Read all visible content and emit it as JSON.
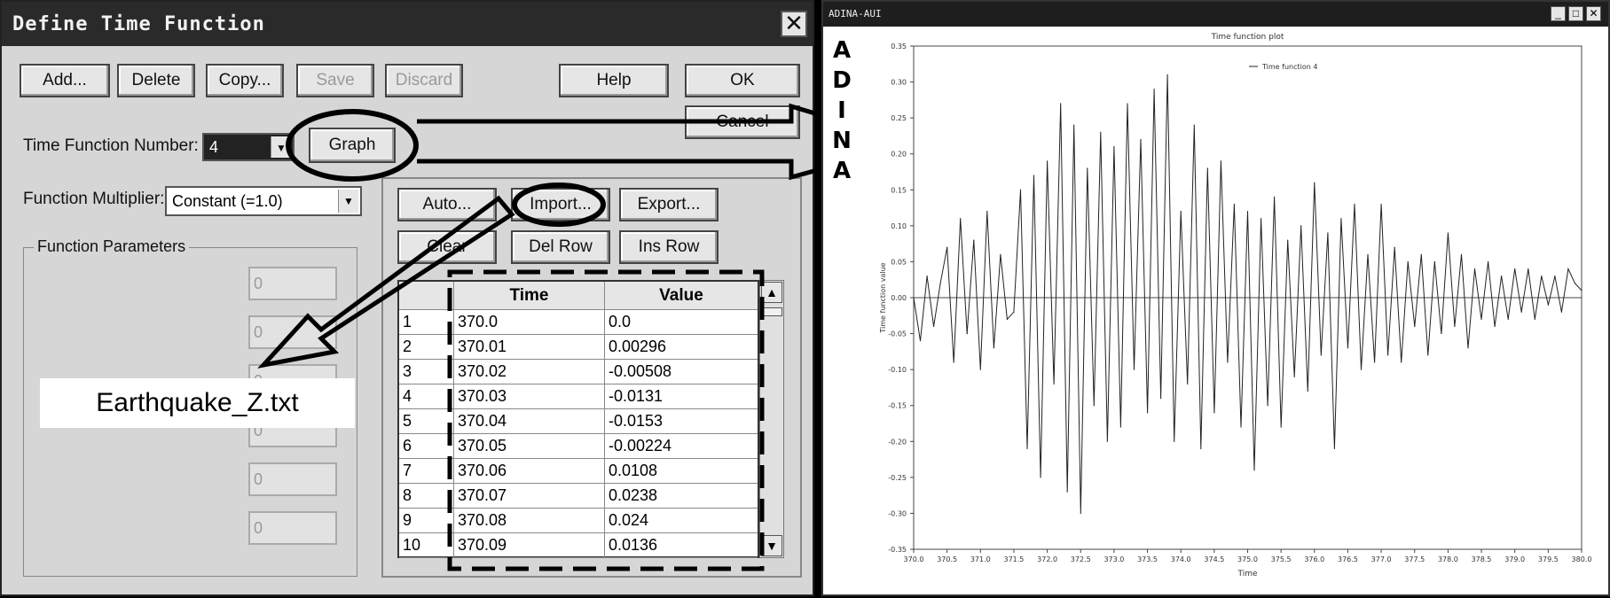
{
  "dialog": {
    "title": "Define Time Function",
    "close_glyph": "✕",
    "buttons": {
      "add": "Add...",
      "delete": "Delete",
      "copy": "Copy...",
      "save": "Save",
      "discard": "Discard",
      "help": "Help",
      "ok": "OK",
      "cancel": "Cancel",
      "graph": "Graph",
      "auto": "Auto...",
      "import": "Import...",
      "export": "Export...",
      "clear": "Clear",
      "del_row": "Del Row",
      "ins_row": "Ins Row"
    },
    "time_function_number_label": "Time Function Number:",
    "time_function_number_value": "4",
    "function_multiplier_label": "Function Multiplier:",
    "function_multiplier_value": "Constant (=1.0)",
    "function_parameters_label": "Function Parameters",
    "parameters": [
      "0",
      "0",
      "0",
      "0",
      "0",
      "0"
    ],
    "table": {
      "columns": [
        "Time",
        "Value"
      ],
      "rows": [
        {
          "n": "1",
          "time": "370.0",
          "value": "0.0"
        },
        {
          "n": "2",
          "time": "370.01",
          "value": "0.00296"
        },
        {
          "n": "3",
          "time": "370.02",
          "value": "-0.00508"
        },
        {
          "n": "4",
          "time": "370.03",
          "value": "-0.0131"
        },
        {
          "n": "5",
          "time": "370.04",
          "value": "-0.0153"
        },
        {
          "n": "6",
          "time": "370.05",
          "value": "-0.00224"
        },
        {
          "n": "7",
          "time": "370.06",
          "value": "0.0108"
        },
        {
          "n": "8",
          "time": "370.07",
          "value": "0.0238"
        },
        {
          "n": "9",
          "time": "370.08",
          "value": "0.024"
        },
        {
          "n": "10",
          "time": "370.09",
          "value": "0.0136"
        }
      ]
    },
    "annotation_filename": "Earthquake_Z.txt"
  },
  "aui_window": {
    "title": "ADINA-AUI",
    "brand_letters": [
      "A",
      "D",
      "I",
      "N",
      "A"
    ]
  },
  "chart_data": {
    "type": "line",
    "title": "Time function plot",
    "xlabel": "Time",
    "ylabel": "Time function value",
    "legend": [
      "Time function 4"
    ],
    "legend_position": "top-center",
    "xlim": [
      370.0,
      380.0
    ],
    "ylim": [
      -0.35,
      0.35
    ],
    "xticks": [
      "370.0",
      "370.5",
      "371.0",
      "371.5",
      "372.0",
      "372.5",
      "373.0",
      "373.5",
      "374.0",
      "374.5",
      "375.0",
      "375.5",
      "376.0",
      "376.5",
      "377.0",
      "377.5",
      "378.0",
      "378.5",
      "379.0",
      "379.5",
      "380.0"
    ],
    "yticks": [
      "0.35",
      "0.30",
      "0.25",
      "0.20",
      "0.15",
      "0.10",
      "0.05",
      "0.00",
      "-0.05",
      "-0.10",
      "-0.15",
      "-0.20",
      "-0.25",
      "-0.30",
      "-0.35"
    ],
    "series": [
      {
        "name": "Time function 4",
        "x": [
          370.0,
          370.1,
          370.2,
          370.3,
          370.4,
          370.5,
          370.6,
          370.7,
          370.8,
          370.9,
          371.0,
          371.1,
          371.2,
          371.3,
          371.4,
          371.5,
          371.6,
          371.7,
          371.8,
          371.9,
          372.0,
          372.1,
          372.2,
          372.3,
          372.4,
          372.5,
          372.6,
          372.7,
          372.8,
          372.9,
          373.0,
          373.1,
          373.2,
          373.3,
          373.4,
          373.5,
          373.6,
          373.7,
          373.8,
          373.9,
          374.0,
          374.1,
          374.2,
          374.3,
          374.4,
          374.5,
          374.6,
          374.7,
          374.8,
          374.9,
          375.0,
          375.1,
          375.2,
          375.3,
          375.4,
          375.5,
          375.6,
          375.7,
          375.8,
          375.9,
          376.0,
          376.1,
          376.2,
          376.3,
          376.4,
          376.5,
          376.6,
          376.7,
          376.8,
          376.9,
          377.0,
          377.1,
          377.2,
          377.3,
          377.4,
          377.5,
          377.6,
          377.7,
          377.8,
          377.9,
          378.0,
          378.1,
          378.2,
          378.3,
          378.4,
          378.5,
          378.6,
          378.7,
          378.8,
          378.9,
          379.0,
          379.1,
          379.2,
          379.3,
          379.4,
          379.5,
          379.6,
          379.7,
          379.8,
          379.9,
          380.0
        ],
        "y": [
          0.0,
          -0.06,
          0.03,
          -0.04,
          0.02,
          0.07,
          -0.09,
          0.11,
          -0.05,
          0.08,
          -0.1,
          0.12,
          -0.07,
          0.06,
          -0.03,
          -0.02,
          0.15,
          -0.21,
          0.17,
          -0.25,
          0.19,
          -0.12,
          0.27,
          -0.27,
          0.24,
          -0.3,
          0.18,
          -0.15,
          0.23,
          -0.2,
          0.21,
          -0.18,
          0.27,
          -0.1,
          0.22,
          -0.16,
          0.29,
          -0.14,
          0.31,
          -0.2,
          0.12,
          -0.12,
          0.24,
          -0.21,
          0.18,
          -0.16,
          0.19,
          -0.09,
          0.13,
          -0.18,
          0.12,
          -0.24,
          0.11,
          -0.15,
          0.14,
          -0.18,
          0.08,
          -0.11,
          0.1,
          -0.13,
          0.16,
          -0.08,
          0.09,
          -0.21,
          0.11,
          -0.07,
          0.13,
          -0.1,
          0.06,
          -0.09,
          0.13,
          -0.08,
          0.07,
          -0.09,
          0.05,
          -0.04,
          0.06,
          -0.08,
          0.05,
          -0.05,
          0.09,
          -0.04,
          0.06,
          -0.07,
          0.04,
          -0.03,
          0.05,
          -0.04,
          0.03,
          -0.03,
          0.04,
          -0.02,
          0.04,
          -0.03,
          0.03,
          -0.01,
          0.03,
          -0.02,
          0.04,
          0.02,
          0.01
        ]
      }
    ],
    "colors": {
      "line": "#222222",
      "axis": "#444444"
    }
  }
}
